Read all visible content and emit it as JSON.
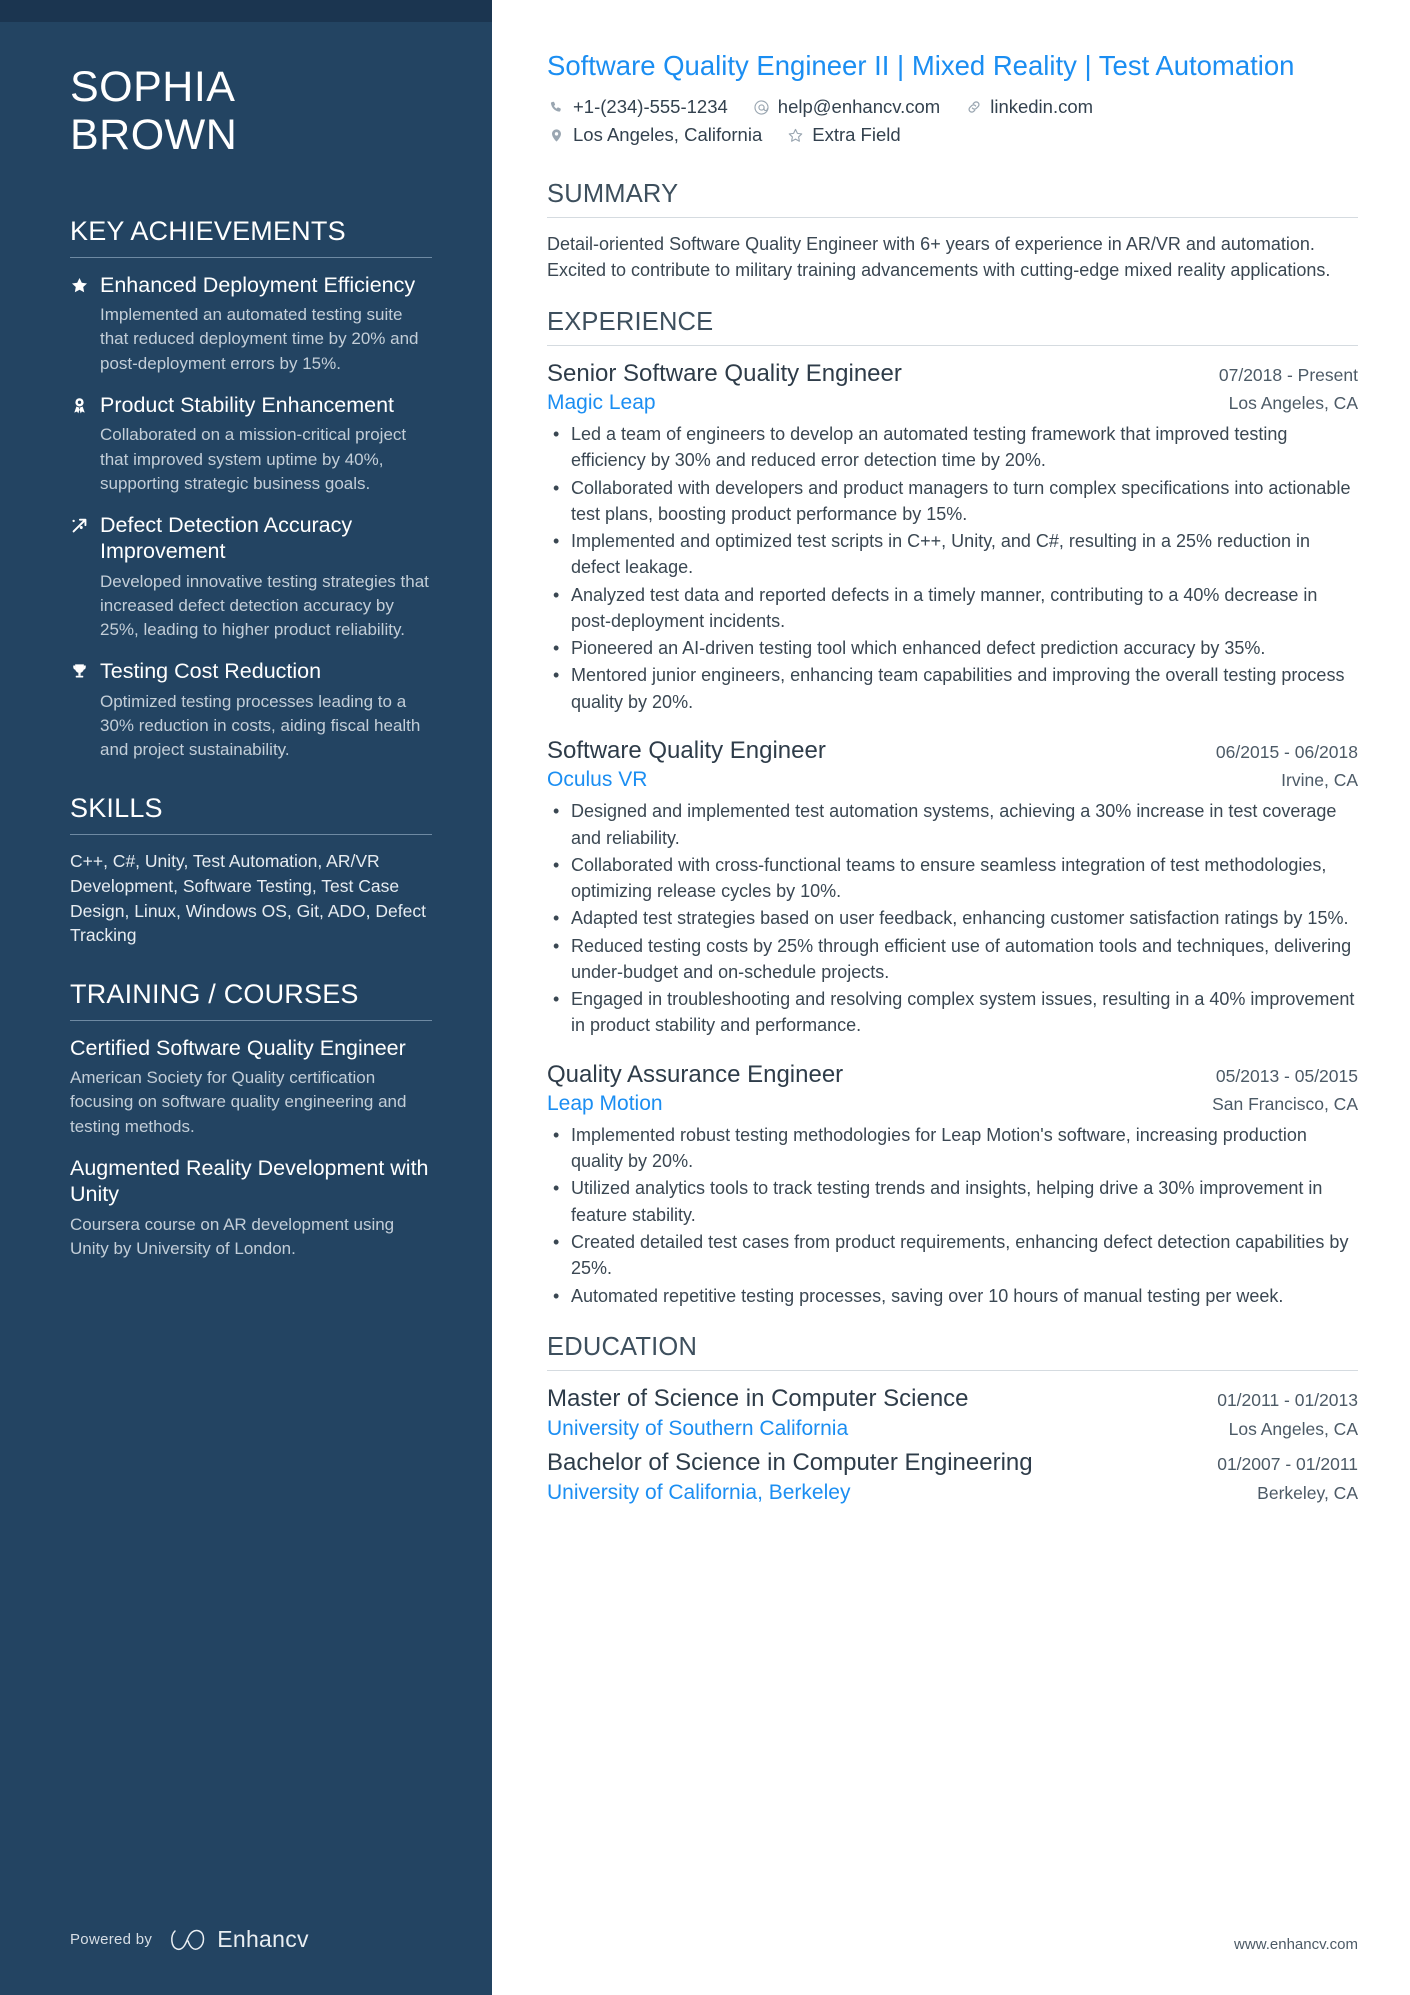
{
  "theme": {
    "sidebar_bg": "#234462",
    "sidebar_top_strip": "#1b3550",
    "accent_blue": "#1b8ef2",
    "heading_dark": "#3d4f5d",
    "body_text": "#3a4752"
  },
  "sidebar": {
    "name": {
      "first": "SOPHIA",
      "last": "BROWN"
    },
    "key_achievements": {
      "heading": "KEY ACHIEVEMENTS",
      "items": [
        {
          "icon": "star-icon",
          "title": "Enhanced Deployment Efficiency",
          "description": "Implemented an automated testing suite that reduced deployment time by 20% and post-deployment errors by 15%."
        },
        {
          "icon": "award-ribbon-icon",
          "title": "Product Stability Enhancement",
          "description": "Collaborated on a mission-critical project that improved system uptime by 40%, supporting strategic business goals."
        },
        {
          "icon": "trending-up-icon",
          "title": "Defect Detection Accuracy Improvement",
          "description": "Developed innovative testing strategies that increased defect detection accuracy by 25%, leading to higher product reliability."
        },
        {
          "icon": "trophy-icon",
          "title": "Testing Cost Reduction",
          "description": "Optimized testing processes leading to a 30% reduction in costs, aiding fiscal health and project sustainability."
        }
      ]
    },
    "skills": {
      "heading": "SKILLS",
      "text": "C++, C#, Unity, Test Automation, AR/VR Development, Software Testing, Test Case Design, Linux, Windows OS, Git, ADO, Defect Tracking"
    },
    "training": {
      "heading": "TRAINING / COURSES",
      "items": [
        {
          "title": "Certified Software Quality Engineer",
          "description": "American Society for Quality certification focusing on software quality engineering and testing methods."
        },
        {
          "title": "Augmented Reality Development with Unity",
          "description": "Coursera course on AR development using Unity by University of London."
        }
      ]
    },
    "footer": {
      "powered_by": "Powered by",
      "brand": "Enhancv"
    }
  },
  "main": {
    "headline": "Software Quality Engineer II | Mixed Reality | Test Automation",
    "contact": {
      "row1": [
        {
          "icon": "phone-icon",
          "text": "+1-(234)-555-1234"
        },
        {
          "icon": "at-email-icon",
          "text": "help@enhancv.com"
        },
        {
          "icon": "link-icon",
          "text": "linkedin.com"
        }
      ],
      "row2": [
        {
          "icon": "location-pin-icon",
          "text": "Los Angeles, California"
        },
        {
          "icon": "star-outline-icon",
          "text": "Extra Field"
        }
      ]
    },
    "summary": {
      "heading": "SUMMARY",
      "text": "Detail-oriented Software Quality Engineer with 6+ years of experience in AR/VR and automation. Excited to contribute to military training advancements with cutting-edge mixed reality applications."
    },
    "experience": {
      "heading": "EXPERIENCE",
      "entries": [
        {
          "title": "Senior Software Quality Engineer",
          "dates": "07/2018 - Present",
          "company": "Magic Leap",
          "location": "Los Angeles, CA",
          "bullets": [
            "Led a team of engineers to develop an automated testing framework that improved testing efficiency by 30% and reduced error detection time by 20%.",
            "Collaborated with developers and product managers to turn complex specifications into actionable test plans, boosting product performance by 15%.",
            "Implemented and optimized test scripts in C++, Unity, and C#, resulting in a 25% reduction in defect leakage.",
            "Analyzed test data and reported defects in a timely manner, contributing to a 40% decrease in post-deployment incidents.",
            "Pioneered an AI-driven testing tool which enhanced defect prediction accuracy by 35%.",
            "Mentored junior engineers, enhancing team capabilities and improving the overall testing process quality by 20%."
          ]
        },
        {
          "title": "Software Quality Engineer",
          "dates": "06/2015 - 06/2018",
          "company": "Oculus VR",
          "location": "Irvine, CA",
          "bullets": [
            "Designed and implemented test automation systems, achieving a 30% increase in test coverage and reliability.",
            "Collaborated with cross-functional teams to ensure seamless integration of test methodologies, optimizing release cycles by 10%.",
            "Adapted test strategies based on user feedback, enhancing customer satisfaction ratings by 15%.",
            "Reduced testing costs by 25% through efficient use of automation tools and techniques, delivering under-budget and on-schedule projects.",
            "Engaged in troubleshooting and resolving complex system issues, resulting in a 40% improvement in product stability and performance."
          ]
        },
        {
          "title": "Quality Assurance Engineer",
          "dates": "05/2013 - 05/2015",
          "company": "Leap Motion",
          "location": "San Francisco, CA",
          "bullets": [
            "Implemented robust testing methodologies for Leap Motion's software, increasing production quality by 20%.",
            "Utilized analytics tools to track testing trends and insights, helping drive a 30% improvement in feature stability.",
            "Created detailed test cases from product requirements, enhancing defect detection capabilities by 25%.",
            "Automated repetitive testing processes, saving over 10 hours of manual testing per week."
          ]
        }
      ]
    },
    "education": {
      "heading": "EDUCATION",
      "entries": [
        {
          "title": "Master of Science in Computer Science",
          "dates": "01/2011 - 01/2013",
          "school": "University of Southern California",
          "location": "Los Angeles, CA"
        },
        {
          "title": "Bachelor of Science in Computer Engineering",
          "dates": "01/2007 - 01/2011",
          "school": "University of California, Berkeley",
          "location": "Berkeley, CA"
        }
      ]
    },
    "footer_url": "www.enhancv.com"
  }
}
